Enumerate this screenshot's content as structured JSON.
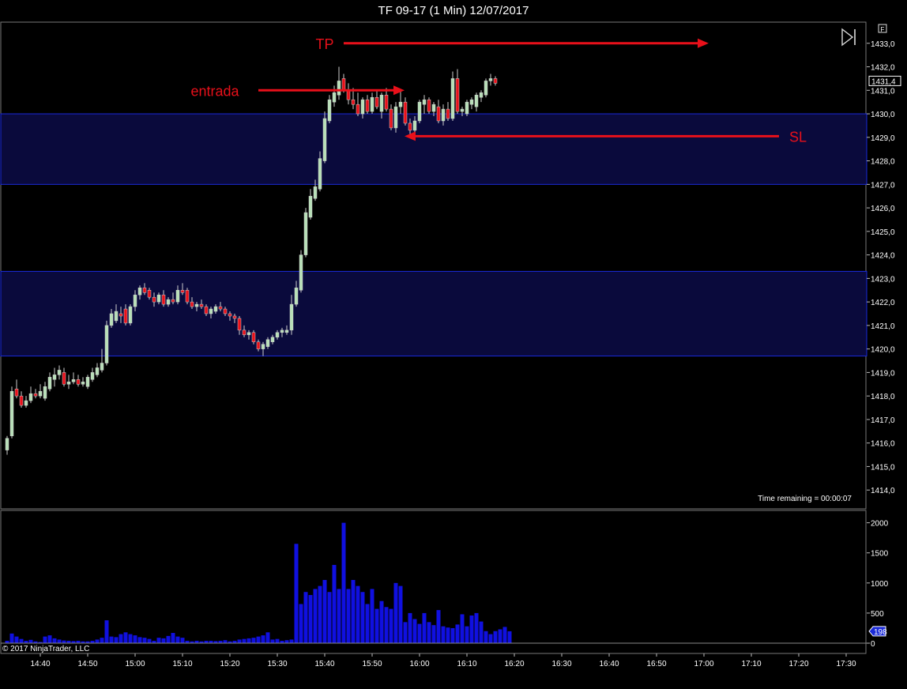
{
  "window": {
    "title": "TF 09-17 (1 Min)  12/07/2017"
  },
  "chart_data": [
    {
      "type": "candlestick",
      "title": "TF 09-17 (1 Min)  12/07/2017",
      "y_range": [
        1413.2,
        1433.9
      ],
      "y_ticks": [
        "1414,0",
        "1415,0",
        "1416,0",
        "1417,0",
        "1418,0",
        "1419,0",
        "1420,0",
        "1421,0",
        "1422,0",
        "1423,0",
        "1424,0",
        "1425,0",
        "1426,0",
        "1427,0",
        "1428,0",
        "1429,0",
        "1430,0",
        "1431,0",
        "1432,0",
        "1433,0"
      ],
      "y_tick_values": [
        1414,
        1415,
        1416,
        1417,
        1418,
        1419,
        1420,
        1421,
        1422,
        1423,
        1424,
        1425,
        1426,
        1427,
        1428,
        1429,
        1430,
        1431,
        1432,
        1433
      ],
      "last_price_label": "1431,4",
      "last_price": 1431.4,
      "zones": [
        {
          "from": 1427.0,
          "to": 1430.0,
          "color": "#0a0a3c"
        },
        {
          "from": 1419.7,
          "to": 1423.3,
          "color": "#0a0a3c"
        }
      ],
      "annotations": [
        {
          "label": "TP",
          "arrow_price": 1433.0,
          "arrow_from_min": 0,
          "arrow_to_min": 76,
          "direction": "right"
        },
        {
          "label": "entrada",
          "arrow_price": 1431.0,
          "arrow_from_min": 35,
          "arrow_to_min": 51,
          "direction": "right"
        },
        {
          "label": "SL",
          "arrow_price": 1429.05,
          "arrow_from_min": 91,
          "arrow_to_min": 51,
          "direction": "left"
        }
      ],
      "time_remaining": "Time remaining = 00:00:07",
      "up_color": "#b8e0b8",
      "down_color": "#e8101a",
      "candles_start": "14:33",
      "candles": [
        {
          "o": 1415.7,
          "h": 1416.3,
          "l": 1415.5,
          "c": 1416.2
        },
        {
          "o": 1416.3,
          "h": 1418.4,
          "l": 1416.2,
          "c": 1418.2
        },
        {
          "o": 1418.3,
          "h": 1418.7,
          "l": 1417.9,
          "c": 1418.0
        },
        {
          "o": 1418.0,
          "h": 1418.2,
          "l": 1417.5,
          "c": 1417.6
        },
        {
          "o": 1417.6,
          "h": 1418.0,
          "l": 1417.5,
          "c": 1417.8
        },
        {
          "o": 1417.8,
          "h": 1418.4,
          "l": 1417.7,
          "c": 1418.1
        },
        {
          "o": 1418.1,
          "h": 1418.3,
          "l": 1417.9,
          "c": 1418.0
        },
        {
          "o": 1418.0,
          "h": 1418.5,
          "l": 1417.9,
          "c": 1418.2
        },
        {
          "o": 1417.9,
          "h": 1418.6,
          "l": 1417.8,
          "c": 1418.4
        },
        {
          "o": 1418.3,
          "h": 1419.0,
          "l": 1418.2,
          "c": 1418.8
        },
        {
          "o": 1418.7,
          "h": 1419.2,
          "l": 1418.4,
          "c": 1418.9
        },
        {
          "o": 1418.9,
          "h": 1419.3,
          "l": 1418.7,
          "c": 1419.1
        },
        {
          "o": 1419.0,
          "h": 1419.2,
          "l": 1418.4,
          "c": 1418.5
        },
        {
          "o": 1418.5,
          "h": 1418.9,
          "l": 1418.3,
          "c": 1418.6
        },
        {
          "o": 1418.6,
          "h": 1419.0,
          "l": 1418.5,
          "c": 1418.7
        },
        {
          "o": 1418.7,
          "h": 1418.9,
          "l": 1418.4,
          "c": 1418.5
        },
        {
          "o": 1418.5,
          "h": 1418.8,
          "l": 1418.4,
          "c": 1418.6
        },
        {
          "o": 1418.4,
          "h": 1418.9,
          "l": 1418.3,
          "c": 1418.8
        },
        {
          "o": 1418.7,
          "h": 1419.2,
          "l": 1418.6,
          "c": 1419.0
        },
        {
          "o": 1418.9,
          "h": 1419.4,
          "l": 1418.8,
          "c": 1419.2
        },
        {
          "o": 1419.1,
          "h": 1420.0,
          "l": 1419.0,
          "c": 1419.4
        },
        {
          "o": 1419.4,
          "h": 1421.2,
          "l": 1419.3,
          "c": 1421.0
        },
        {
          "o": 1421.0,
          "h": 1421.7,
          "l": 1420.9,
          "c": 1421.5
        },
        {
          "o": 1421.2,
          "h": 1421.9,
          "l": 1421.1,
          "c": 1421.6
        },
        {
          "o": 1421.5,
          "h": 1421.8,
          "l": 1421.1,
          "c": 1421.4
        },
        {
          "o": 1421.7,
          "h": 1421.9,
          "l": 1421.0,
          "c": 1421.1
        },
        {
          "o": 1421.1,
          "h": 1421.9,
          "l": 1421.0,
          "c": 1421.8
        },
        {
          "o": 1421.8,
          "h": 1422.5,
          "l": 1421.6,
          "c": 1422.3
        },
        {
          "o": 1422.3,
          "h": 1422.7,
          "l": 1422.1,
          "c": 1422.6
        },
        {
          "o": 1422.6,
          "h": 1422.8,
          "l": 1422.3,
          "c": 1422.4
        },
        {
          "o": 1422.5,
          "h": 1422.6,
          "l": 1422.1,
          "c": 1422.2
        },
        {
          "o": 1422.2,
          "h": 1422.4,
          "l": 1421.8,
          "c": 1422.0
        },
        {
          "o": 1422.0,
          "h": 1422.4,
          "l": 1421.9,
          "c": 1422.3
        },
        {
          "o": 1422.3,
          "h": 1422.5,
          "l": 1421.8,
          "c": 1421.9
        },
        {
          "o": 1421.9,
          "h": 1422.2,
          "l": 1421.8,
          "c": 1422.1
        },
        {
          "o": 1422.1,
          "h": 1422.4,
          "l": 1421.9,
          "c": 1422.0
        },
        {
          "o": 1422.0,
          "h": 1422.7,
          "l": 1421.9,
          "c": 1422.5
        },
        {
          "o": 1422.5,
          "h": 1422.8,
          "l": 1422.3,
          "c": 1422.4
        },
        {
          "o": 1422.5,
          "h": 1422.6,
          "l": 1421.9,
          "c": 1422.0
        },
        {
          "o": 1422.0,
          "h": 1422.2,
          "l": 1421.7,
          "c": 1421.8
        },
        {
          "o": 1421.8,
          "h": 1422.0,
          "l": 1421.6,
          "c": 1421.9
        },
        {
          "o": 1421.9,
          "h": 1422.1,
          "l": 1421.7,
          "c": 1421.8
        },
        {
          "o": 1421.8,
          "h": 1421.9,
          "l": 1421.4,
          "c": 1421.5
        },
        {
          "o": 1421.5,
          "h": 1421.8,
          "l": 1421.3,
          "c": 1421.7
        },
        {
          "o": 1421.6,
          "h": 1421.9,
          "l": 1421.5,
          "c": 1421.8
        },
        {
          "o": 1421.8,
          "h": 1422.0,
          "l": 1421.6,
          "c": 1421.7
        },
        {
          "o": 1421.7,
          "h": 1421.8,
          "l": 1421.4,
          "c": 1421.5
        },
        {
          "o": 1421.5,
          "h": 1421.6,
          "l": 1421.2,
          "c": 1421.4
        },
        {
          "o": 1421.4,
          "h": 1421.5,
          "l": 1421.1,
          "c": 1421.3
        },
        {
          "o": 1421.3,
          "h": 1421.4,
          "l": 1420.6,
          "c": 1420.8
        },
        {
          "o": 1420.8,
          "h": 1421.0,
          "l": 1420.5,
          "c": 1420.6
        },
        {
          "o": 1420.6,
          "h": 1420.8,
          "l": 1420.4,
          "c": 1420.7
        },
        {
          "o": 1420.7,
          "h": 1420.8,
          "l": 1420.2,
          "c": 1420.3
        },
        {
          "o": 1420.3,
          "h": 1420.4,
          "l": 1419.9,
          "c": 1420.0
        },
        {
          "o": 1420.0,
          "h": 1420.3,
          "l": 1419.7,
          "c": 1420.2
        },
        {
          "o": 1420.1,
          "h": 1420.5,
          "l": 1420.0,
          "c": 1420.4
        },
        {
          "o": 1420.3,
          "h": 1420.6,
          "l": 1420.2,
          "c": 1420.5
        },
        {
          "o": 1420.5,
          "h": 1420.8,
          "l": 1420.4,
          "c": 1420.7
        },
        {
          "o": 1420.7,
          "h": 1420.9,
          "l": 1420.5,
          "c": 1420.8
        },
        {
          "o": 1420.7,
          "h": 1421.0,
          "l": 1420.6,
          "c": 1420.8
        },
        {
          "o": 1420.8,
          "h": 1422.3,
          "l": 1420.6,
          "c": 1421.9
        },
        {
          "o": 1421.9,
          "h": 1422.9,
          "l": 1421.8,
          "c": 1422.6
        },
        {
          "o": 1422.5,
          "h": 1424.2,
          "l": 1422.4,
          "c": 1424.0
        },
        {
          "o": 1424.0,
          "h": 1426.0,
          "l": 1423.9,
          "c": 1425.8
        },
        {
          "o": 1425.6,
          "h": 1426.8,
          "l": 1425.5,
          "c": 1426.5
        },
        {
          "o": 1426.4,
          "h": 1427.2,
          "l": 1426.3,
          "c": 1426.9
        },
        {
          "o": 1426.8,
          "h": 1428.4,
          "l": 1426.7,
          "c": 1428.1
        },
        {
          "o": 1428.0,
          "h": 1430.1,
          "l": 1427.9,
          "c": 1429.8
        },
        {
          "o": 1429.7,
          "h": 1430.8,
          "l": 1429.6,
          "c": 1430.6
        },
        {
          "o": 1430.5,
          "h": 1431.2,
          "l": 1430.3,
          "c": 1430.9
        },
        {
          "o": 1430.8,
          "h": 1432.0,
          "l": 1430.6,
          "c": 1431.4
        },
        {
          "o": 1431.5,
          "h": 1431.7,
          "l": 1430.9,
          "c": 1431.0
        },
        {
          "o": 1431.0,
          "h": 1431.3,
          "l": 1430.4,
          "c": 1430.6
        },
        {
          "o": 1430.6,
          "h": 1431.1,
          "l": 1430.2,
          "c": 1430.4
        },
        {
          "o": 1430.4,
          "h": 1430.9,
          "l": 1429.9,
          "c": 1430.0
        },
        {
          "o": 1430.0,
          "h": 1430.7,
          "l": 1429.8,
          "c": 1430.6
        },
        {
          "o": 1430.6,
          "h": 1430.8,
          "l": 1430.0,
          "c": 1430.1
        },
        {
          "o": 1430.1,
          "h": 1430.9,
          "l": 1430.0,
          "c": 1430.7
        },
        {
          "o": 1430.7,
          "h": 1431.0,
          "l": 1430.2,
          "c": 1430.3
        },
        {
          "o": 1430.1,
          "h": 1430.9,
          "l": 1429.8,
          "c": 1430.8
        },
        {
          "o": 1430.8,
          "h": 1431.1,
          "l": 1430.1,
          "c": 1430.2
        },
        {
          "o": 1430.2,
          "h": 1430.4,
          "l": 1429.3,
          "c": 1429.4
        },
        {
          "o": 1429.4,
          "h": 1430.5,
          "l": 1429.2,
          "c": 1430.3
        },
        {
          "o": 1430.3,
          "h": 1431.0,
          "l": 1430.0,
          "c": 1430.5
        },
        {
          "o": 1430.5,
          "h": 1430.7,
          "l": 1429.5,
          "c": 1429.6
        },
        {
          "o": 1429.6,
          "h": 1429.8,
          "l": 1429.1,
          "c": 1429.3
        },
        {
          "o": 1429.3,
          "h": 1429.9,
          "l": 1429.0,
          "c": 1429.7
        },
        {
          "o": 1429.7,
          "h": 1430.6,
          "l": 1429.6,
          "c": 1430.5
        },
        {
          "o": 1430.4,
          "h": 1430.8,
          "l": 1430.0,
          "c": 1430.6
        },
        {
          "o": 1430.6,
          "h": 1430.7,
          "l": 1430.0,
          "c": 1430.1
        },
        {
          "o": 1430.1,
          "h": 1430.5,
          "l": 1429.9,
          "c": 1430.4
        },
        {
          "o": 1430.3,
          "h": 1430.6,
          "l": 1429.6,
          "c": 1429.7
        },
        {
          "o": 1429.7,
          "h": 1430.4,
          "l": 1429.5,
          "c": 1430.2
        },
        {
          "o": 1430.2,
          "h": 1430.5,
          "l": 1429.7,
          "c": 1429.8
        },
        {
          "o": 1429.8,
          "h": 1431.8,
          "l": 1429.7,
          "c": 1431.5
        },
        {
          "o": 1431.5,
          "h": 1431.9,
          "l": 1430.0,
          "c": 1430.1
        },
        {
          "o": 1430.1,
          "h": 1430.3,
          "l": 1429.9,
          "c": 1430.2
        },
        {
          "o": 1430.0,
          "h": 1430.6,
          "l": 1429.9,
          "c": 1430.5
        },
        {
          "o": 1430.4,
          "h": 1430.7,
          "l": 1430.2,
          "c": 1430.6
        },
        {
          "o": 1430.3,
          "h": 1430.9,
          "l": 1430.1,
          "c": 1430.8
        },
        {
          "o": 1430.7,
          "h": 1431.0,
          "l": 1430.5,
          "c": 1430.9
        },
        {
          "o": 1430.8,
          "h": 1431.5,
          "l": 1430.7,
          "c": 1431.4
        },
        {
          "o": 1431.4,
          "h": 1431.7,
          "l": 1431.2,
          "c": 1431.5
        },
        {
          "o": 1431.5,
          "h": 1431.6,
          "l": 1431.2,
          "c": 1431.3
        }
      ],
      "x_tick_labels": [
        "14:40",
        "14:50",
        "15:00",
        "15:10",
        "15:20",
        "15:30",
        "15:40",
        "15:50",
        "16:00",
        "16:10",
        "16:20",
        "16:30",
        "16:40",
        "16:50",
        "17:00",
        "17:10",
        "17:20",
        "17:30"
      ],
      "x_tick_minutes": [
        7,
        17,
        27,
        37,
        47,
        57,
        67,
        77,
        87,
        97,
        107,
        117,
        127,
        137,
        147,
        157,
        167,
        177
      ]
    },
    {
      "type": "bar",
      "title": "",
      "y_range": [
        0,
        2100
      ],
      "y_ticks": [
        "0",
        "500",
        "1000",
        "1500",
        "2000"
      ],
      "y_tick_values": [
        0,
        500,
        1000,
        1500,
        2000
      ],
      "last_value_label": "198",
      "last_value": 198,
      "bar_color": "#1010e0",
      "values": [
        40,
        160,
        110,
        70,
        40,
        55,
        30,
        20,
        110,
        130,
        80,
        60,
        45,
        40,
        35,
        40,
        30,
        30,
        40,
        60,
        90,
        380,
        110,
        100,
        150,
        180,
        150,
        130,
        100,
        90,
        70,
        40,
        90,
        80,
        120,
        170,
        110,
        90,
        40,
        30,
        40,
        30,
        40,
        40,
        35,
        40,
        50,
        30,
        40,
        60,
        70,
        80,
        90,
        110,
        130,
        180,
        60,
        70,
        40,
        50,
        60,
        1650,
        650,
        850,
        800,
        900,
        950,
        1050,
        850,
        1300,
        900,
        2000,
        900,
        1050,
        950,
        850,
        650,
        900,
        570,
        700,
        600,
        570,
        1000,
        950,
        350,
        500,
        400,
        320,
        500,
        350,
        300,
        550,
        280,
        260,
        250,
        310,
        480,
        280,
        460,
        500,
        360,
        200,
        150,
        200,
        230,
        270,
        198
      ]
    }
  ],
  "footer": {
    "copyright": "© 2017 NinjaTrader, LLC"
  },
  "controls": {
    "flag_label": "F"
  }
}
